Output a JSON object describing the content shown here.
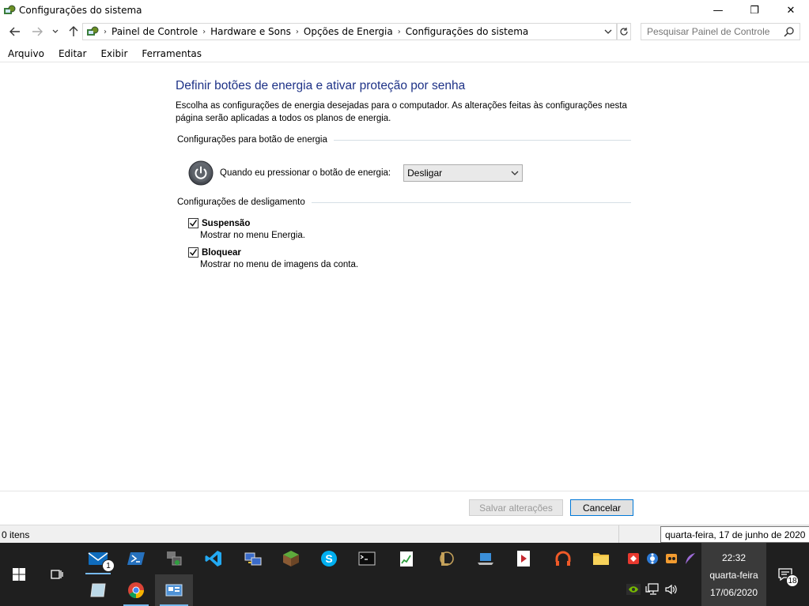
{
  "window": {
    "title": "Configurações do sistema",
    "minimize_label": "—",
    "maximize_label": "❐",
    "close_label": "✕"
  },
  "address": {
    "crumbs": [
      "Painel de Controle",
      "Hardware e Sons",
      "Opções de Energia",
      "Configurações do sistema"
    ],
    "search_placeholder": "Pesquisar Painel de Controle"
  },
  "menu": {
    "items": [
      "Arquivo",
      "Editar",
      "Exibir",
      "Ferramentas"
    ]
  },
  "content": {
    "title": "Definir botões de energia e ativar proteção por senha",
    "description": "Escolha as configurações de energia desejadas para o computador. As alterações feitas às configurações nesta página serão aplicadas a todos os planos de energia.",
    "power_section": "Configurações para botão de energia",
    "power_button_label": "Quando eu pressionar o botão de energia:",
    "power_button_value": "Desligar",
    "shutdown_section": "Configurações de desligamento",
    "options": [
      {
        "label": "Suspensão",
        "description": "Mostrar no menu Energia.",
        "checked": true
      },
      {
        "label": "Bloquear",
        "description": "Mostrar no menu de imagens da conta.",
        "checked": true
      }
    ]
  },
  "buttons": {
    "save": "Salvar alterações",
    "cancel": "Cancelar"
  },
  "status": {
    "items": "0 itens",
    "tooltip": "quarta-feira, 17 de junho de 2020"
  },
  "taskbar": {
    "mail_badge": "1",
    "notification_count": "18",
    "clock_time": "22:32",
    "clock_day": "quarta-feira",
    "clock_date": "17/06/2020"
  },
  "colors": {
    "title_blue": "#1e3287",
    "taskbar": "#1f1f1f",
    "accent": "#0078d7"
  }
}
